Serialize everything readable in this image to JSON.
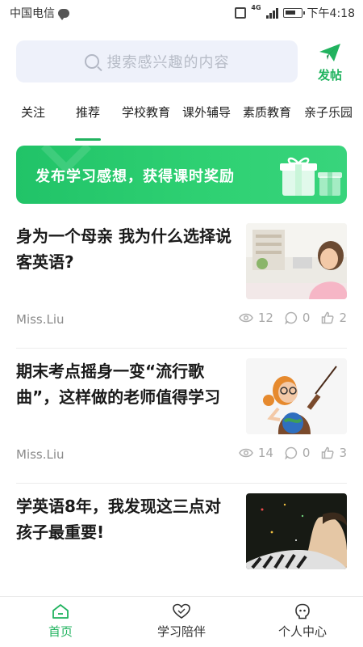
{
  "status_bar": {
    "carrier": "中国电信",
    "network": "4G",
    "time": "下午4:18",
    "icons": [
      "chat-icon",
      "vibrate-icon",
      "signal-icon",
      "battery-icon"
    ]
  },
  "header": {
    "search_placeholder": "搜索感兴趣的内容",
    "post_label": "发帖",
    "accent_color": "#21b35f"
  },
  "tabs": [
    {
      "label": "关注",
      "active": false
    },
    {
      "label": "推荐",
      "active": true
    },
    {
      "label": "学校教育",
      "active": false
    },
    {
      "label": "课外辅导",
      "active": false
    },
    {
      "label": "素质教育",
      "active": false
    },
    {
      "label": "亲子乐园",
      "active": false
    }
  ],
  "banner": {
    "text": "发布学习感想，获得课时奖励",
    "icon": "gift-icon"
  },
  "articles": [
    {
      "title": "身为一个母亲 我为什么选择说客英语?",
      "author": "Miss.Liu",
      "views": "12",
      "comments": "0",
      "likes": "2",
      "image": "girl-studying-photo"
    },
    {
      "title": "期末考点摇身一变“流行歌曲”，这样做的老师值得学习",
      "author": "Miss.Liu",
      "views": "14",
      "comments": "0",
      "likes": "3",
      "image": "teacher-illustration"
    },
    {
      "title": "学英语8年，我发现这三点对孩子最重要!",
      "image": "woman-dark-photo"
    }
  ],
  "bottom_nav": [
    {
      "label": "首页",
      "icon": "home-icon",
      "active": true
    },
    {
      "label": "学习陪伴",
      "icon": "heart-icon",
      "active": false
    },
    {
      "label": "个人中心",
      "icon": "profile-icon",
      "active": false
    }
  ]
}
